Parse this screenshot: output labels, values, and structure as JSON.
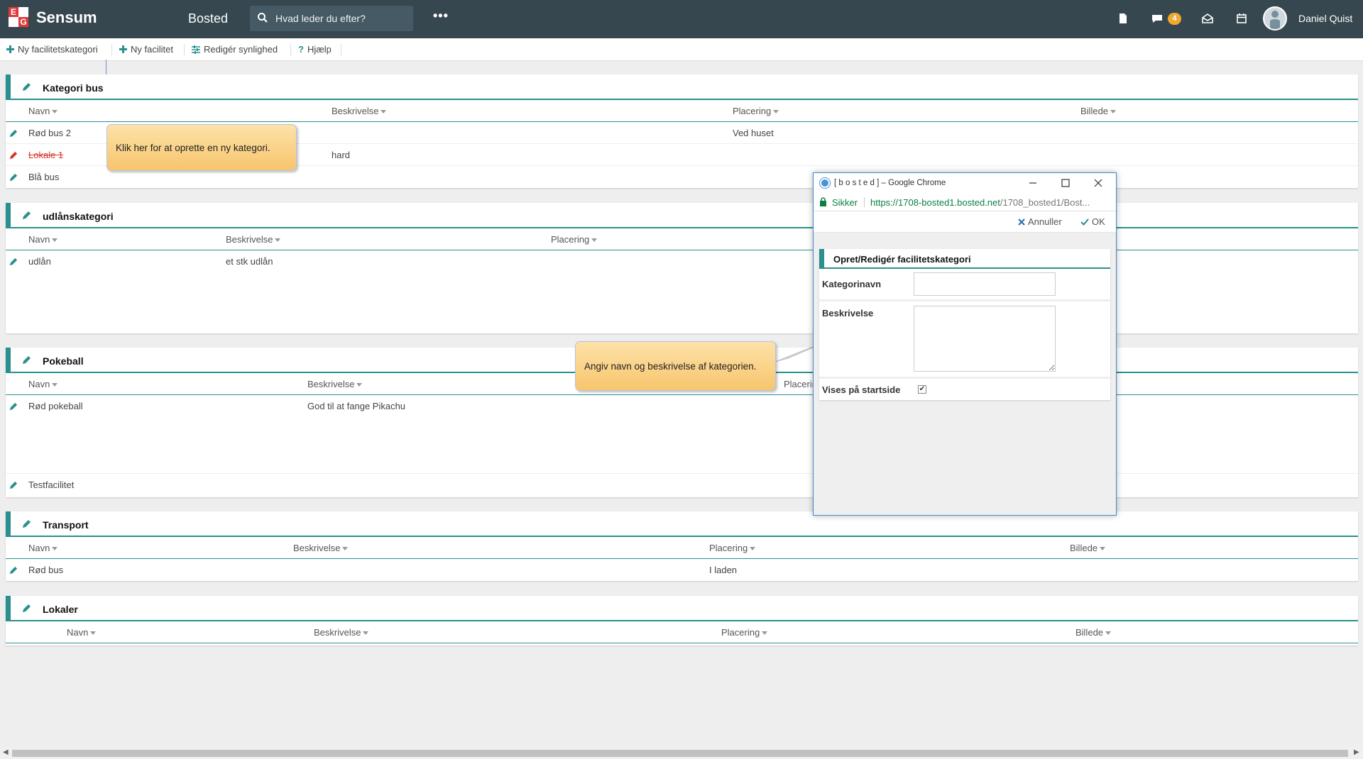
{
  "topbar": {
    "brand": "Sensum",
    "logo_letters": [
      "E",
      "G"
    ],
    "app_title": "Bosted",
    "search_placeholder": "Hvad leder du efter?",
    "more_label": "•••",
    "messages_badge": "4",
    "username": "Daniel Quist",
    "icons": [
      "document-icon",
      "chat-icon",
      "inbox-icon",
      "calendar-icon"
    ],
    "bg_color": "#37474f"
  },
  "toolbar": {
    "new_category": "Ny facilitetskategori",
    "new_facility": "Ny facilitet",
    "edit_visibility": "Redigér synlighed",
    "help": "Hjælp"
  },
  "columns": {
    "name": "Navn",
    "description": "Beskrivelse",
    "placement": "Placering",
    "image": "Billede"
  },
  "categories": [
    {
      "title": "Kategori bus",
      "rows": [
        {
          "name": "Rød bus 2",
          "description": "",
          "placement": "Ved huset"
        },
        {
          "name": "Lokale 1",
          "description": "hard",
          "placement": "",
          "struck": true
        },
        {
          "name": "Blå bus",
          "description": "",
          "placement": ""
        }
      ]
    },
    {
      "title": "udlånskategori",
      "rows": [
        {
          "name": "udlån",
          "description": "et stk udlån",
          "placement": ""
        }
      ]
    },
    {
      "title": "Pokeball",
      "rows": [
        {
          "name": "Rød pokeball",
          "description": "God til at fange Pikachu",
          "placement": ""
        },
        {
          "name": "Testfacilitet",
          "description": "",
          "placement": ""
        }
      ]
    },
    {
      "title": "Transport",
      "rows": [
        {
          "name": "Rød bus",
          "description": "",
          "placement": "I laden"
        }
      ]
    },
    {
      "title": "Lokaler",
      "rows": []
    }
  ],
  "tooltips": {
    "new_category": "Klik her for at oprette en ny kategori.",
    "name_description": "Angiv navn og beskrivelse af kategorien."
  },
  "popup": {
    "window_title": "[ b o s t e d ] – Google Chrome",
    "secure_label": "Sikker",
    "url_main": "https://1708-bosted1.bosted.net",
    "url_rest": "/1708_bosted1/Bost...",
    "cancel_label": "Annuller",
    "ok_label": "OK",
    "form_title": "Opret/Redigér facilitetskategori",
    "field_name_label": "Kategorinavn",
    "field_name_value": "",
    "field_description_label": "Beskrivelse",
    "field_description_value": "",
    "field_show_label": "Vises på startside",
    "field_show_checked": true
  },
  "colors": {
    "accent": "#2a8f8f",
    "tooltip": "#f7c56d",
    "badge": "#f0a830",
    "secure": "#0b8043"
  }
}
